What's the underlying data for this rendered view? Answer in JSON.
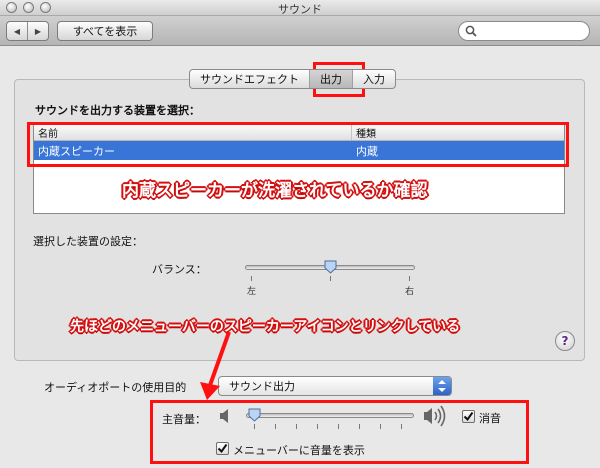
{
  "window": {
    "title": "サウンド"
  },
  "toolbar": {
    "show_all_label": "すべてを表示",
    "back_icon": "◀",
    "forward_icon": "▶"
  },
  "tabs": [
    {
      "label": "サウンドエフェクト",
      "selected": false
    },
    {
      "label": "出力",
      "selected": true
    },
    {
      "label": "入力",
      "selected": false
    }
  ],
  "output": {
    "section_title": "サウンドを出力する装置を選択：",
    "columns": [
      "名前",
      "種類"
    ],
    "rows": [
      {
        "name": "内蔵スピーカー",
        "type": "内蔵",
        "selected": true
      }
    ],
    "device_settings_title": "選択した装置の設定：",
    "balance_label": "バランス：",
    "balance_left": "左",
    "balance_right": "右",
    "balance_value": 0.5
  },
  "help_label": "?",
  "audio_port": {
    "label": "オーディオポートの使用目的",
    "selected": "サウンド出力"
  },
  "volume": {
    "label": "主音量：",
    "value": 0.05,
    "mute_label": "消音",
    "mute_checked": true,
    "show_in_menubar_label": "メニューバーに音量を表示",
    "show_in_menubar_checked": true
  },
  "annotations": {
    "table_note": "内蔵スピーカーが洗濯されているか確認",
    "menubar_note": "先ほどのメニューバーのスピーカーアイコンとリンクしている"
  },
  "colors": {
    "selection": "#3875d7",
    "annotation_red": "#ff1010"
  }
}
